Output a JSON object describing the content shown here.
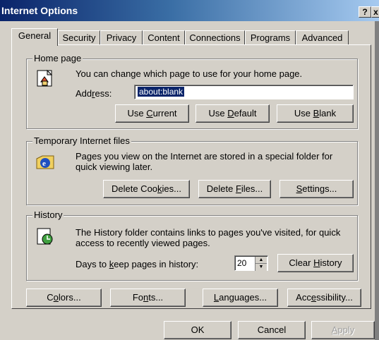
{
  "window": {
    "title": "Internet Options",
    "help_glyph": "?",
    "close_glyph": "x"
  },
  "tabs": [
    {
      "label": "General"
    },
    {
      "label": "Security"
    },
    {
      "label": "Privacy"
    },
    {
      "label": "Content"
    },
    {
      "label": "Connections"
    },
    {
      "label": "Programs"
    },
    {
      "label": "Advanced"
    }
  ],
  "home_page": {
    "legend": "Home page",
    "description": "You can change which page to use for your home page.",
    "address_label": "Address:",
    "address_value": "about:blank",
    "btn_current": "Use Current",
    "btn_default": "Use Default",
    "btn_blank": "Use Blank"
  },
  "temp_files": {
    "legend": "Temporary Internet files",
    "description_line1": "Pages you view on the Internet are stored in a special folder for",
    "description_line2": "quick viewing later.",
    "btn_cookies": "Delete Cookies...",
    "btn_files": "Delete Files...",
    "btn_settings": "Settings..."
  },
  "history": {
    "legend": "History",
    "description_line1": "The History folder contains links to pages you've visited, for quick",
    "description_line2": "access to recently viewed pages.",
    "days_label": "Days to keep pages in history:",
    "days_value": "20",
    "btn_clear": "Clear History"
  },
  "bottom_buttons": {
    "colors": "Colors...",
    "fonts": "Fonts...",
    "languages": "Languages...",
    "accessibility": "Accessibility..."
  },
  "dialog_buttons": {
    "ok": "OK",
    "cancel": "Cancel",
    "apply": "Apply"
  }
}
